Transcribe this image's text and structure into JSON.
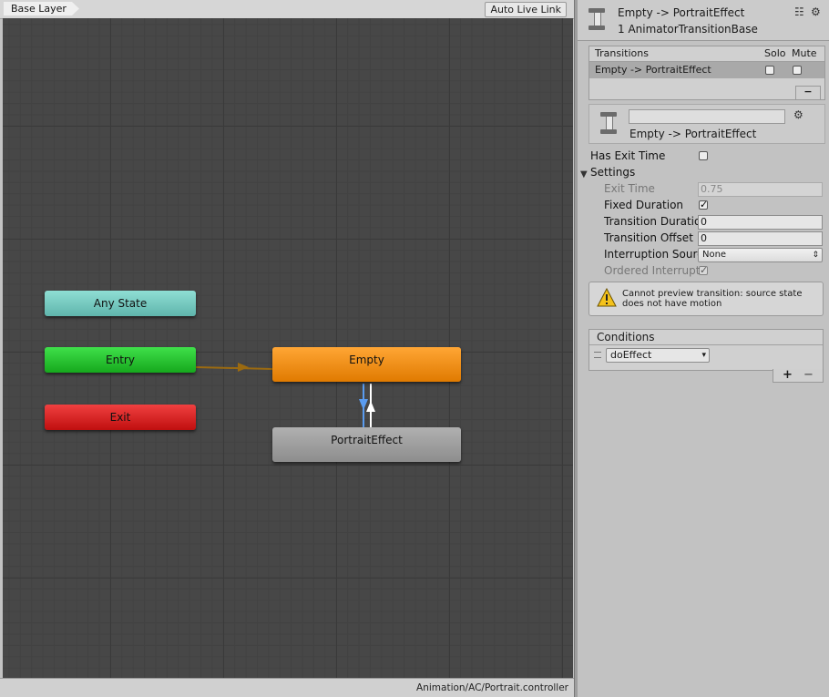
{
  "graph": {
    "breadcrumb": "Base Layer",
    "auto_live_link": "Auto Live Link",
    "states": {
      "any_state": "Any State",
      "entry": "Entry",
      "exit": "Exit",
      "empty": "Empty",
      "portrait_effect": "PortraitEffect"
    },
    "controller_path": "Animation/AC/Portrait.controller"
  },
  "inspector": {
    "header_title": "Empty -> PortraitEffect",
    "header_subtitle": "1 AnimatorTransitionBase",
    "transitions": {
      "heading": "Transitions",
      "solo_label": "Solo",
      "mute_label": "Mute",
      "rows": [
        {
          "name": "Empty -> PortraitEffect",
          "solo": false,
          "mute": false
        }
      ],
      "remove_label": "−"
    },
    "transition": {
      "name_value": "",
      "title": "Empty -> PortraitEffect",
      "has_exit_time_label": "Has Exit Time",
      "has_exit_time": false,
      "settings_label": "Settings",
      "exit_time_label": "Exit Time",
      "exit_time_value": "0.75",
      "fixed_duration_label": "Fixed Duration",
      "fixed_duration": true,
      "transition_duration_label": "Transition Duratio",
      "transition_duration_value": "0",
      "transition_offset_label": "Transition Offset",
      "transition_offset_value": "0",
      "interruption_source_label": "Interruption Sourc",
      "interruption_source_value": "None",
      "ordered_interruption_label": "Ordered Interrupt",
      "ordered_interruption": true
    },
    "warning": {
      "line1": "Cannot preview transition: source state",
      "line2": "does not have motion"
    },
    "conditions": {
      "heading": "Conditions",
      "items": [
        {
          "parameter": "doEffect"
        }
      ],
      "add_label": "+",
      "remove_label": "−"
    }
  },
  "colors": {
    "canvas_bg": "#474747",
    "any_state": "#6fc7bd",
    "entry": "#22b92a",
    "exit": "#d62020",
    "empty_default_state": "#f08c10",
    "regular_state": "#9a9a9a",
    "selected_transition": "#5a9cf0"
  }
}
